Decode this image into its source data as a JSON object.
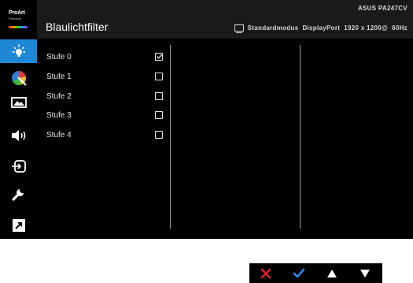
{
  "brand": {
    "line1": "ProArt",
    "line2": "Premium"
  },
  "header": {
    "title": "Blaulichtfilter",
    "model": "ASUS PA247CV",
    "mode": "Standardmodus",
    "input": "DisplayPort",
    "resolution": "1920 x 1200@",
    "refresh": "60Hz"
  },
  "sidebar": {
    "items": [
      {
        "icon": "blue-light-icon",
        "active": true
      },
      {
        "icon": "color-icon",
        "active": false
      },
      {
        "icon": "image-icon",
        "active": false
      },
      {
        "icon": "sound-icon",
        "active": false
      },
      {
        "icon": "input-select-icon",
        "active": false
      },
      {
        "icon": "system-setup-icon",
        "active": false
      },
      {
        "icon": "shortcut-icon",
        "active": false
      }
    ],
    "accent": "#1e88d6"
  },
  "options": [
    {
      "label": "Stufe 0",
      "checked": true
    },
    {
      "label": "Stufe 1",
      "checked": false
    },
    {
      "label": "Stufe 2",
      "checked": false
    },
    {
      "label": "Stufe 3",
      "checked": false
    },
    {
      "label": "Stufe 4",
      "checked": false
    }
  ],
  "controls": [
    {
      "icon": "close-icon",
      "color": "#e0202a"
    },
    {
      "icon": "check-icon",
      "color": "#2a8cf0"
    },
    {
      "icon": "up-arrow-icon",
      "color": "#ffffff"
    },
    {
      "icon": "down-arrow-icon",
      "color": "#ffffff"
    }
  ]
}
